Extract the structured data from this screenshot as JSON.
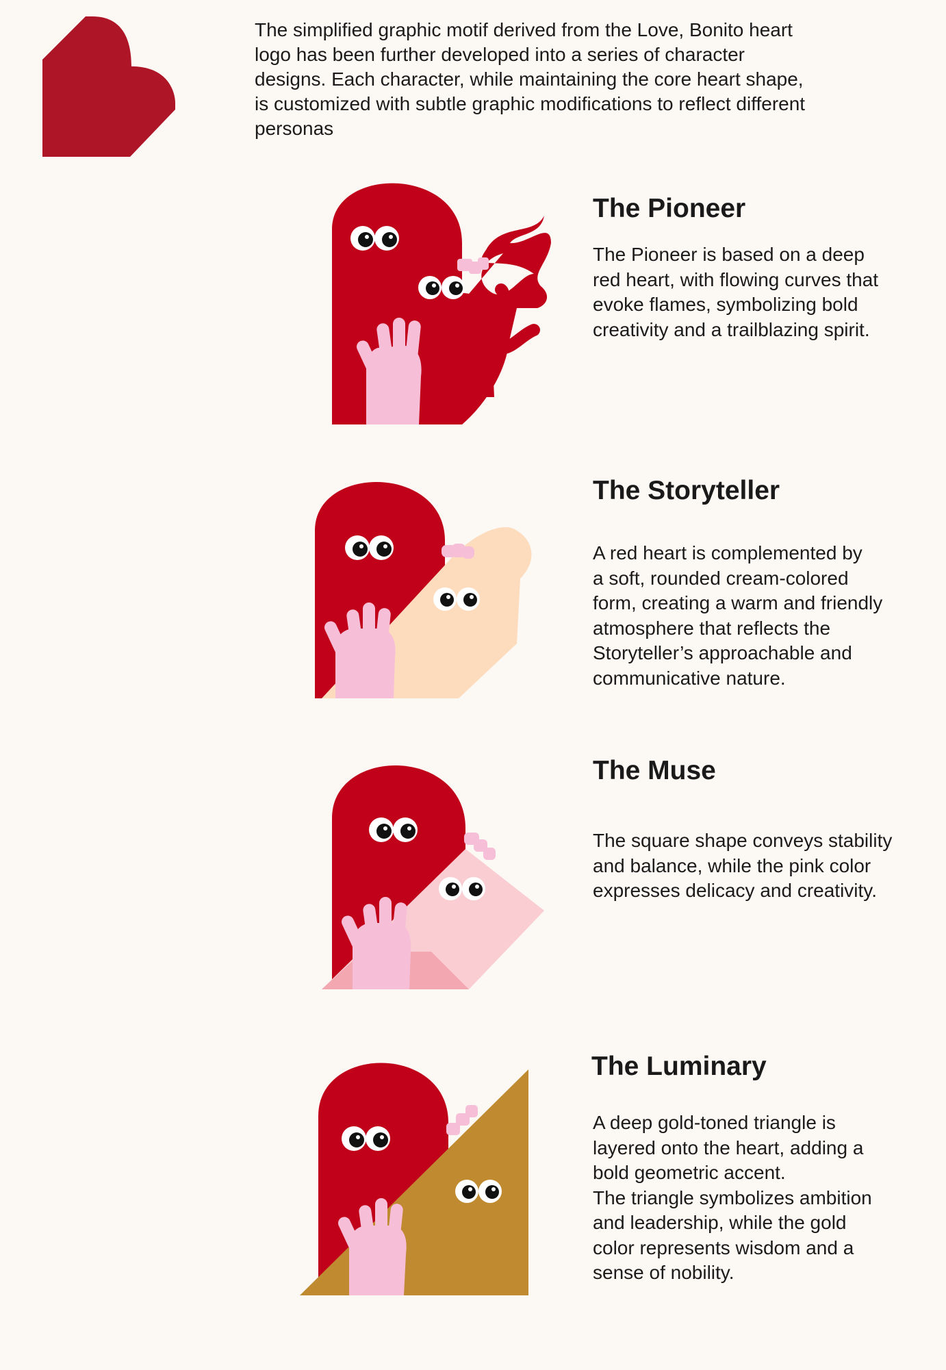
{
  "logo": {
    "icon": "heart-logo-icon",
    "color": "#ae1527"
  },
  "intro": {
    "text": "The simplified graphic motif derived from the Love, Bonito heart logo has been further developed into a series of character designs. Each character, while maintaining the core heart shape, is customized with subtle graphic modifications to reflect different personas"
  },
  "colors": {
    "background": "#fcf8f3",
    "heart_red": "#c1001a",
    "hand_pink": "#f6bfd7",
    "cream": "#fddbbd",
    "muse_pink": "#f9cdd1",
    "gold": "#bf8a30"
  },
  "characters": [
    {
      "title": "The Pioneer",
      "description": "The Pioneer is based on a deep\nred heart, with flowing curves that\nevoke flames, symbolizing bold\ncreativity and a trailblazing spirit."
    },
    {
      "title": "The Storyteller",
      "description": "A red heart is complemented by\na soft, rounded cream-colored\nform, creating a warm and friendly\natmosphere that reflects the\nStoryteller’s approachable and\ncommunicative nature."
    },
    {
      "title": "The Muse",
      "description": "The square shape conveys stability\nand balance, while the pink color\nexpresses delicacy and creativity."
    },
    {
      "title": "The Luminary",
      "description": "A deep gold-toned triangle is\nlayered onto the heart, adding a\nbold geometric accent.\nThe triangle symbolizes ambition\nand leadership, while the gold\ncolor represents wisdom and a\nsense of nobility."
    }
  ]
}
